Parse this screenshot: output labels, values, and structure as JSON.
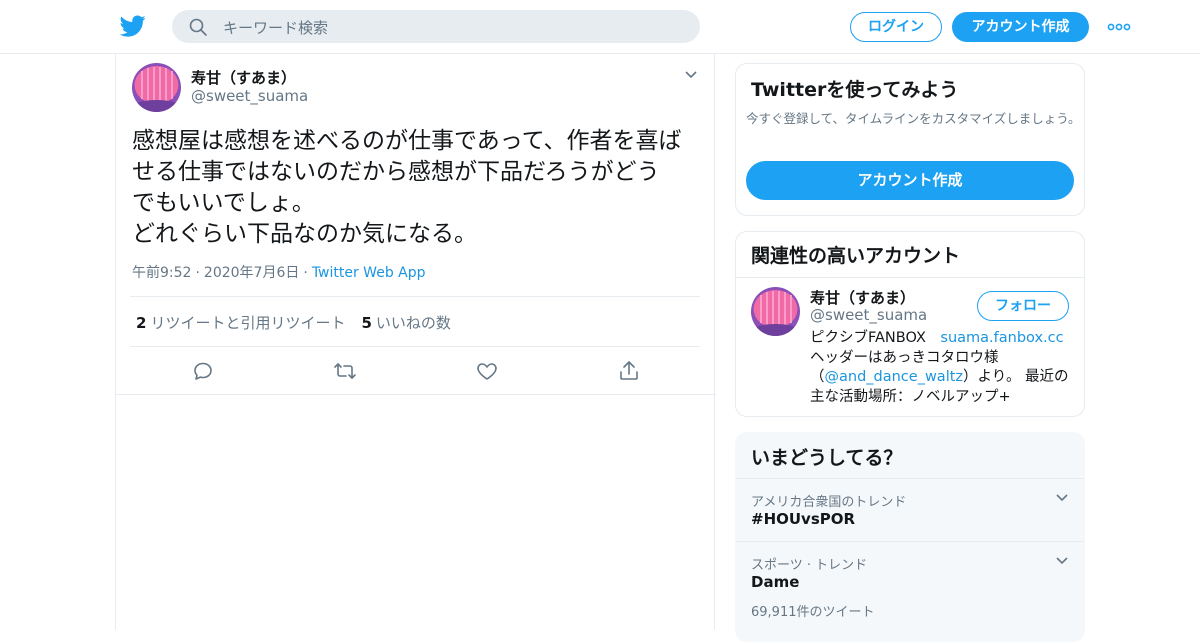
{
  "header": {
    "search_placeholder": "キーワード検索",
    "login_label": "ログイン",
    "signup_label": "アカウント作成"
  },
  "tweet": {
    "author_name": "寿甘（すあま）",
    "author_handle": "@sweet_suama",
    "text": "感想屋は感想を述べるのが仕事であって、作者を喜ば\nせる仕事ではないのだから感想が下品だろうがどう\nでもいいでしょ。\nどれぐらい下品なのか気になる。",
    "time": "午前9:52",
    "date": "2020年7月6日",
    "source": "Twitter Web App",
    "retweet_count": "2",
    "retweet_label": "リツイートと引用リツイート",
    "like_count": "5",
    "like_label": "いいねの数"
  },
  "sidebar": {
    "try_card": {
      "title": "Twitterを使ってみよう",
      "description": "今すぐ登録して、タイムラインをカスタマイズしましょう。",
      "cta_label": "アカウント作成"
    },
    "related": {
      "title": "関連性の高いアカウント",
      "name": "寿甘（すあま）",
      "handle": "@sweet_suama",
      "follow_label": "フォロー",
      "bio_part1": "ピクシブFANBOX　",
      "bio_link1": "suama.fanbox.cc",
      "bio_part2": "ヘッダーはあっきコタロウ様（",
      "bio_link2": "@and_dance_waltz",
      "bio_part3": "）より。 最近の主な活動場所：ノベルアップ+"
    },
    "trends": {
      "title": "いまどうしてる？",
      "items": [
        {
          "context": "アメリカ合衆国のトレンド",
          "name": "#HOUvsPOR",
          "count": ""
        },
        {
          "context": "スポーツ · トレンド",
          "name": "Dame",
          "count": "69,911件のツイート"
        }
      ]
    }
  },
  "colors": {
    "accent": "#1da1f2",
    "link": "#1b95e0",
    "muted_text": "#657786",
    "border": "#e6ecf0",
    "trend_bg": "#f5f8fa"
  },
  "icons": [
    "twitter-bird-icon",
    "search-icon",
    "more-dots-icon",
    "chevron-down-icon",
    "reply-icon",
    "retweet-icon",
    "like-heart-icon",
    "share-icon"
  ]
}
